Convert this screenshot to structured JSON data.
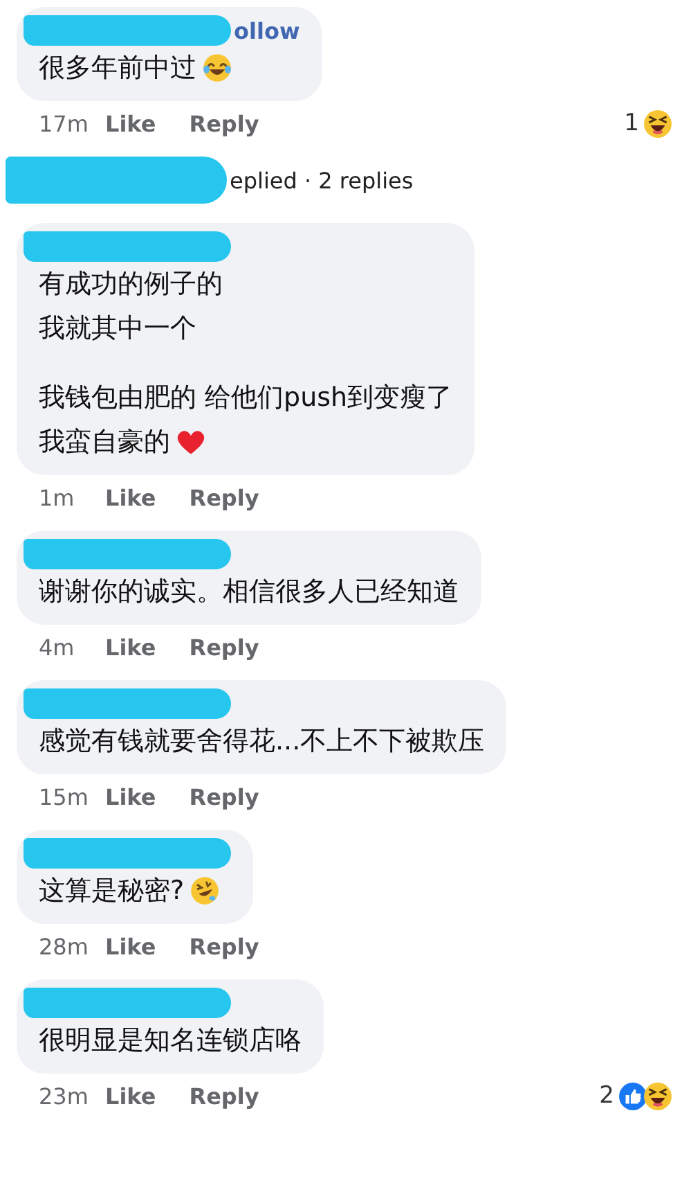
{
  "items": [
    {
      "kind": "comment",
      "header_text": "ollow",
      "paragraphs": [
        [
          "很多年前中过"
        ]
      ],
      "emoji": {
        "kind": "laugh"
      },
      "time": "17m",
      "like": "Like",
      "reply": "Reply",
      "reactions": {
        "count": "1",
        "icons": [
          {
            "kind": "haha"
          }
        ]
      }
    },
    {
      "kind": "replies",
      "text": "eplied · 2 replies"
    },
    {
      "kind": "comment",
      "paragraphs": [
        [
          "有成功的例子的",
          "我就其中一个"
        ],
        [
          "我钱包由肥的 给他们push到变瘦了",
          "我蛮自豪的"
        ]
      ],
      "emoji": {
        "kind": "heart"
      },
      "time": "1m",
      "like": "Like",
      "reply": "Reply"
    },
    {
      "kind": "comment",
      "paragraphs": [
        [
          "谢谢你的诚实。相信很多人已经知道"
        ]
      ],
      "time": "4m",
      "like": "Like",
      "reply": "Reply"
    },
    {
      "kind": "comment",
      "paragraphs": [
        [
          "感觉有钱就要舍得花...不上不下被欺压"
        ]
      ],
      "time": "15m",
      "like": "Like",
      "reply": "Reply"
    },
    {
      "kind": "comment",
      "paragraphs": [
        [
          "这算是秘密?"
        ]
      ],
      "emoji": {
        "kind": "rofl"
      },
      "time": "28m",
      "like": "Like",
      "reply": "Reply"
    },
    {
      "kind": "comment",
      "paragraphs": [
        [
          "很明显是知名连锁店咯"
        ]
      ],
      "time": "23m",
      "like": "Like",
      "reply": "Reply",
      "reactions": {
        "count": "2",
        "icons": [
          {
            "kind": "like"
          },
          {
            "kind": "haha"
          }
        ]
      }
    }
  ]
}
